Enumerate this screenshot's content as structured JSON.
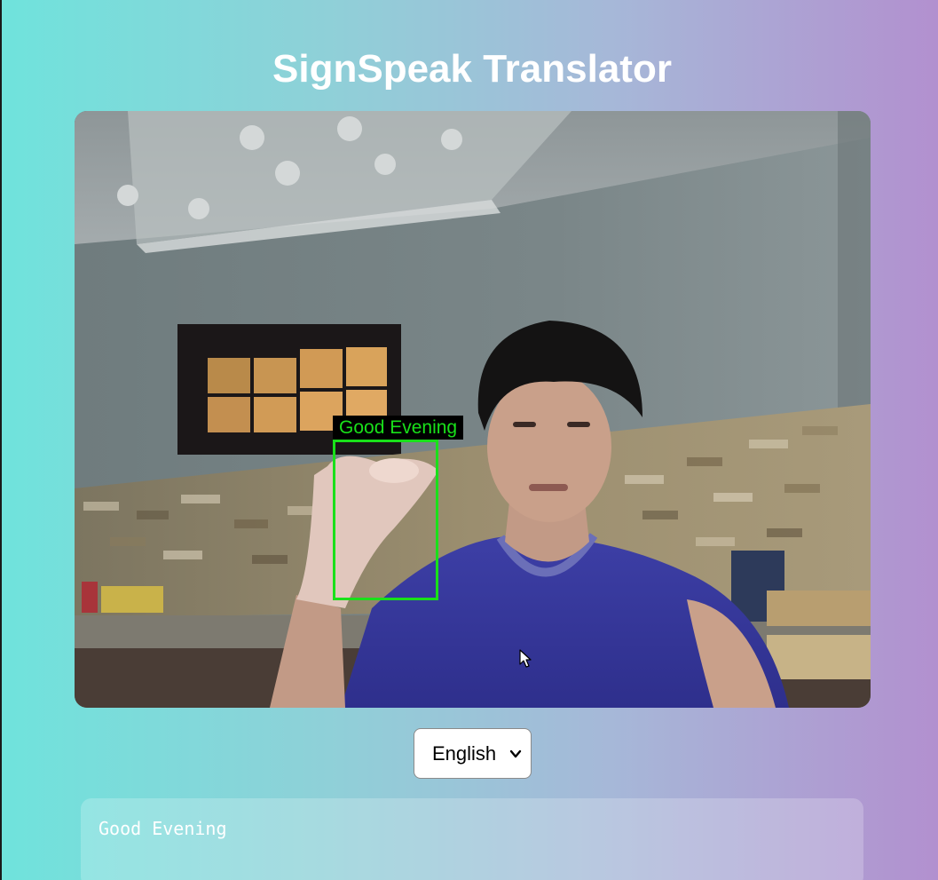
{
  "app": {
    "title": "SignSpeak Translator"
  },
  "video": {
    "detection_label": "Good Evening",
    "box_color": "#19e01a"
  },
  "language": {
    "selected": "English"
  },
  "output": {
    "text": "Good Evening"
  },
  "icons": {
    "dropdown": "chevron-down-icon",
    "cursor": "mouse-pointer-icon"
  },
  "colors": {
    "gradient_start": "#6fe3dc",
    "gradient_end": "#b290cf",
    "title": "#ffffff"
  }
}
